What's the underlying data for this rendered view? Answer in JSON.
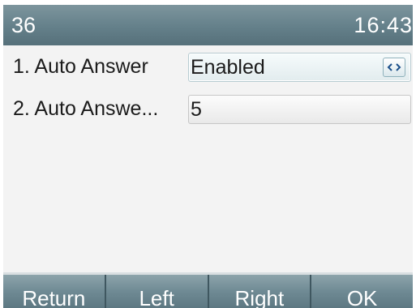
{
  "status_bar": {
    "left": "36",
    "time": "16:43"
  },
  "settings": [
    {
      "index_label": "1. Auto Answer",
      "value": "Enabled",
      "has_switch": true
    },
    {
      "index_label": "2. Auto Answe...",
      "value": "5",
      "has_switch": false
    }
  ],
  "softkeys": [
    "Return",
    "Left",
    "Right",
    "OK"
  ],
  "icons": {
    "switch": "left-right-arrows-icon"
  },
  "colors": {
    "header": "#64808a",
    "softkey_bar": "#6f8a94",
    "focus_field": "#e2ecee",
    "background": "#f3f3f3"
  }
}
